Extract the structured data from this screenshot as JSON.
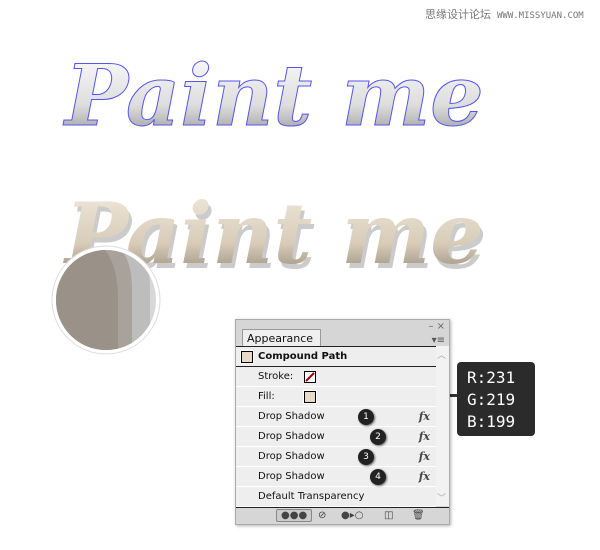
{
  "watermark": {
    "cn": "思缘设计论坛",
    "url": "WWW.MISSYUAN.COM"
  },
  "artwork": {
    "text": "Paint me",
    "fill_color": "#e7dbc7",
    "anchor_color": "#4b4bff"
  },
  "panel": {
    "tab": "Appearance",
    "close": "×",
    "title": "Compound Path",
    "stroke_label": "Stroke:",
    "fill_label": "Fill:",
    "effects": [
      {
        "label": "Drop Shadow",
        "badge": "1"
      },
      {
        "label": "Drop Shadow",
        "badge": "2"
      },
      {
        "label": "Drop Shadow",
        "badge": "3"
      },
      {
        "label": "Drop Shadow",
        "badge": "4"
      }
    ],
    "fx": "fx",
    "transparency": "Default Transparency"
  },
  "tooltip": {
    "r": "R:231",
    "g": "G:219",
    "b": "B:199"
  }
}
